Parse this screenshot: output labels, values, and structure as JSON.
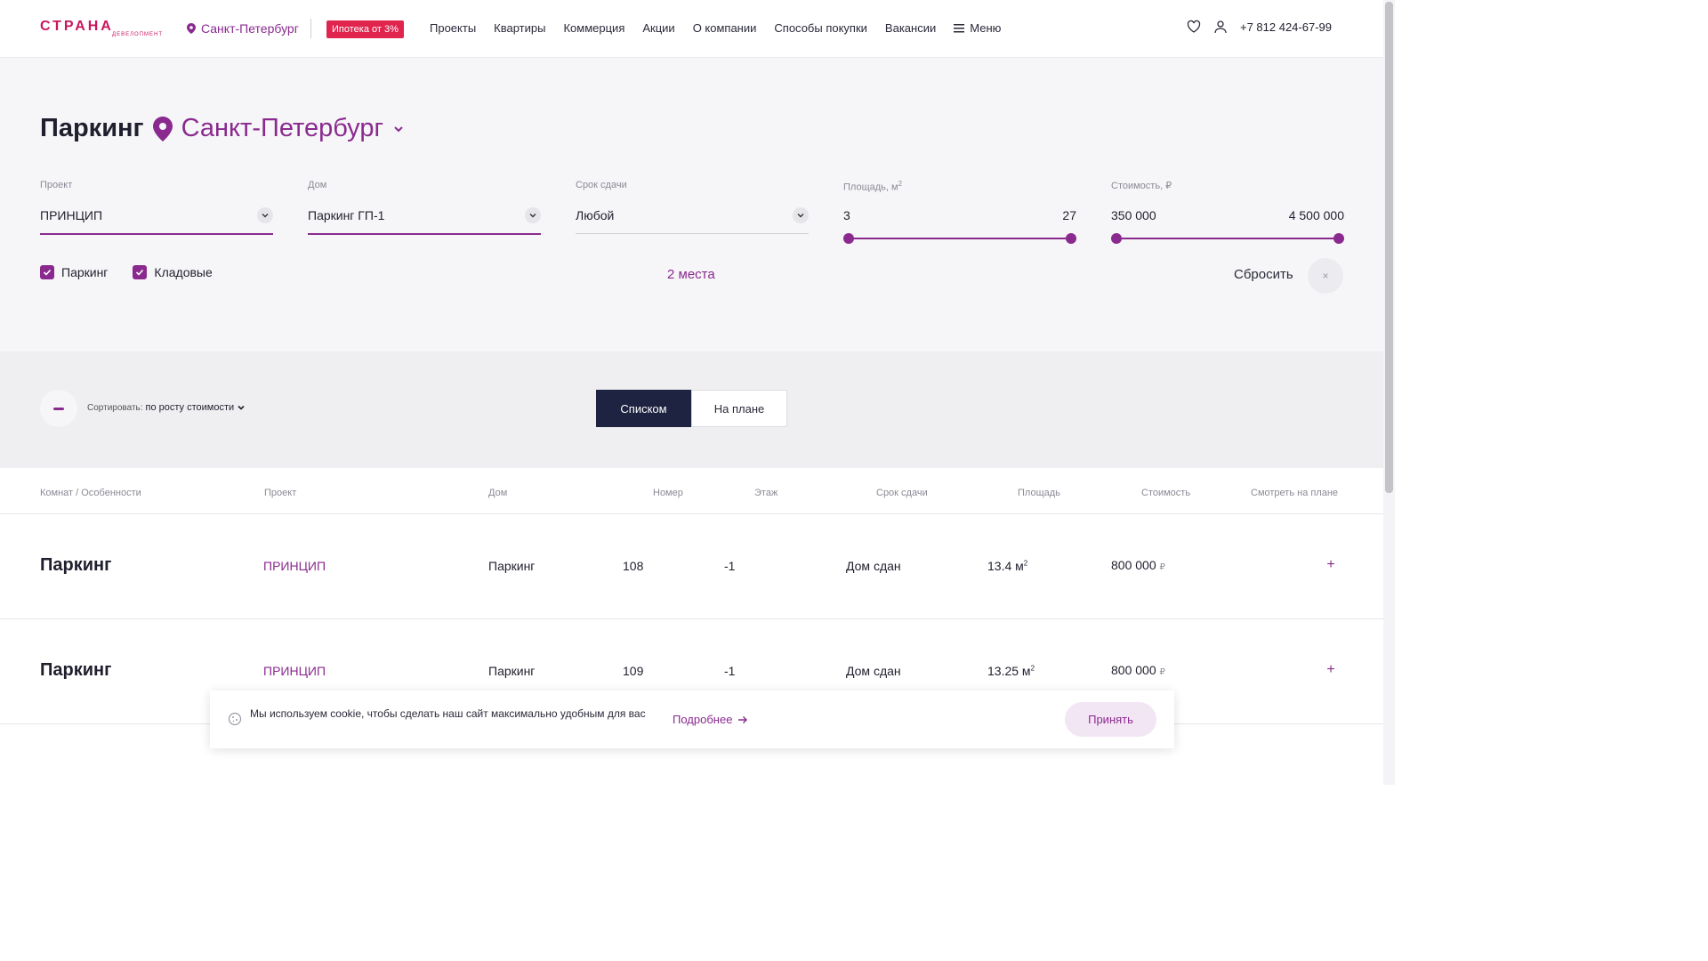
{
  "header": {
    "logo_text": "СТРАНА",
    "logo_sub": "ДЕВЕЛОПМЕНТ",
    "city": "Санкт-Петербург",
    "mortgage_badge": "Ипотека от 3%",
    "nav": [
      "Проекты",
      "Квартиры",
      "Коммерция",
      "Акции",
      "О компании",
      "Способы покупки",
      "Вакансии"
    ],
    "menu_label": "Меню",
    "phone": "+7 812 424-67-99"
  },
  "page": {
    "title": "Паркинг",
    "city": "Санкт-Петербург"
  },
  "filters": {
    "project": {
      "label": "Проект",
      "value": "ПРИНЦИП"
    },
    "house": {
      "label": "Дом",
      "value": "Паркинг ГП-1"
    },
    "term": {
      "label": "Срок сдачи",
      "value": "Любой"
    },
    "area": {
      "label": "Площадь, м",
      "label_sup": "2",
      "min": "3",
      "max": "27"
    },
    "price": {
      "label": "Стоимость, ₽",
      "min": "350 000",
      "max": "4 500 000"
    },
    "check_parking": "Паркинг",
    "check_storage": "Кладовые",
    "result_count": "2 места",
    "reset_label": "Сбросить",
    "reset_icon": "×"
  },
  "view": {
    "sort_prefix": "Сортировать:",
    "sort_value": "по росту стоимости",
    "tab_list": "Списком",
    "tab_plan": "На плане"
  },
  "table": {
    "headers": [
      "Комнат / Особенности",
      "Проект",
      "Дом",
      "Номер",
      "Этаж",
      "Срок сдачи",
      "Площадь",
      "Стоимость",
      "Смотреть на плане"
    ],
    "rows": [
      {
        "type": "Паркинг",
        "project": "ПРИНЦИП",
        "house": "Паркинг",
        "number": "108",
        "floor": "-1",
        "term": "Дом сдан",
        "area": "13.4 м",
        "price": "800 000",
        "currency": "₽",
        "plus": "+"
      },
      {
        "type": "Паркинг",
        "project": "ПРИНЦИП",
        "house": "Паркинг",
        "number": "109",
        "floor": "-1",
        "term": "Дом сдан",
        "area": "13.25 м",
        "price": "800 000",
        "currency": "₽",
        "plus": "+"
      }
    ],
    "area_sup": "2"
  },
  "cookie": {
    "text": "Мы используем cookie, чтобы сделать наш сайт максимально удобным для вас",
    "more": "Подробнее",
    "accept": "Принять"
  },
  "colors": {
    "accent": "#8a2a8f",
    "brand": "#c8175d",
    "badge": "#e0244e",
    "dark_tab": "#1d2340"
  }
}
